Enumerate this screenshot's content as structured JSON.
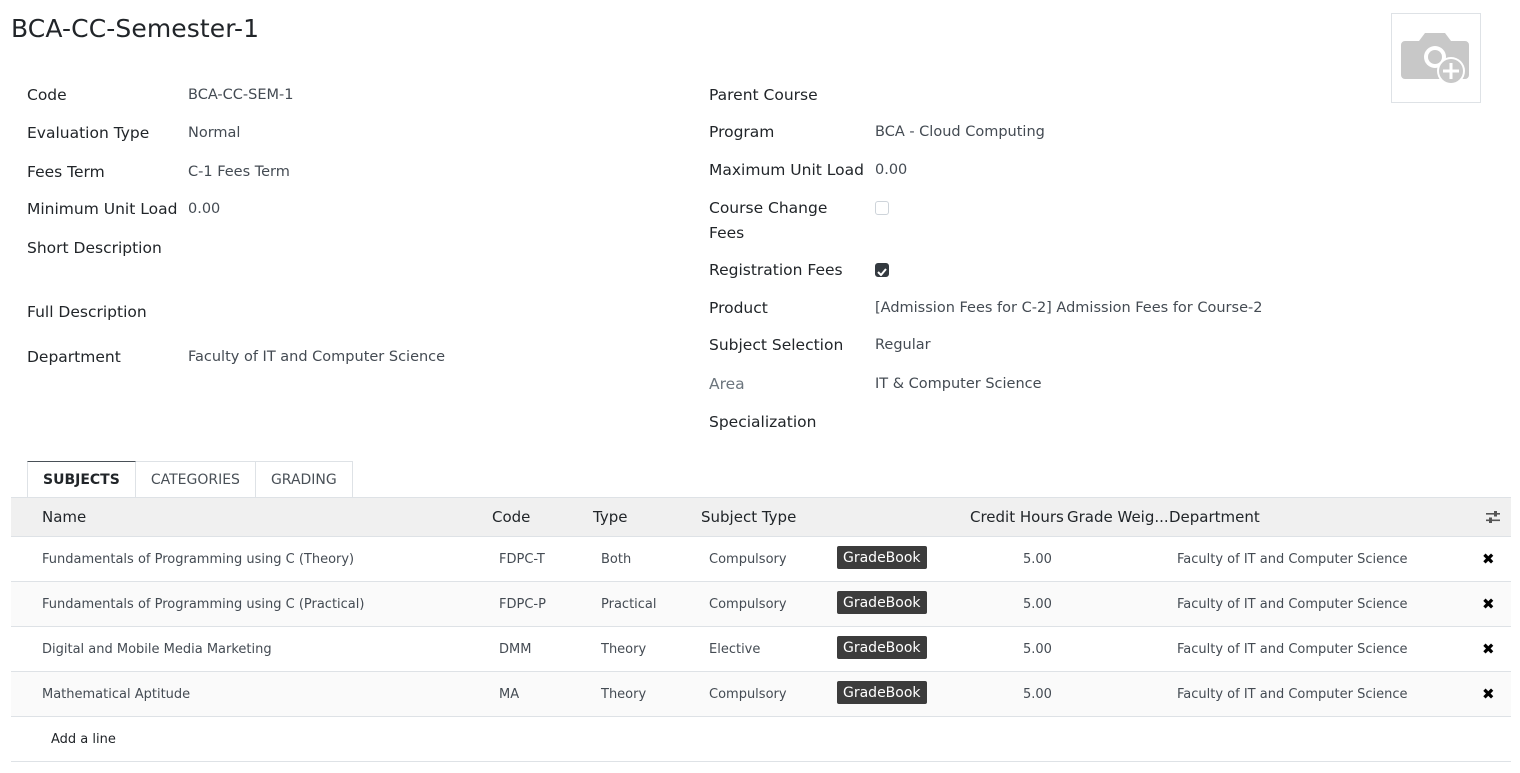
{
  "title": "BCA-CC-Semester-1",
  "avatar": {
    "icon": "camera-plus-icon"
  },
  "left_fields": [
    {
      "label": "Code",
      "value": "BCA-CC-SEM-1"
    },
    {
      "label": "Evaluation Type",
      "value": "Normal"
    },
    {
      "label": "Fees Term",
      "value": "C-1 Fees Term"
    },
    {
      "label": "Minimum Unit Load",
      "value": "0.00"
    },
    {
      "label": "Short Description",
      "value": ""
    },
    {
      "label": "Full Description",
      "value": ""
    },
    {
      "label": "Department",
      "value": "Faculty of IT and Computer Science"
    }
  ],
  "right_fields": {
    "parent_course": {
      "label": "Parent Course",
      "value": ""
    },
    "program": {
      "label": "Program",
      "value": "BCA - Cloud Computing"
    },
    "max_unit_load": {
      "label": "Maximum Unit Load",
      "value": "0.00"
    },
    "course_change_fees": {
      "label_line1": "Course Change",
      "label_line2": "Fees",
      "checked": false
    },
    "registration_fees": {
      "label": "Registration Fees",
      "checked": true
    },
    "product": {
      "label": "Product",
      "value": "[Admission Fees for C-2] Admission Fees for Course-2"
    },
    "subject_selection": {
      "label": "Subject Selection",
      "value": "Regular"
    },
    "area": {
      "label": "Area",
      "value": "IT & Computer Science"
    },
    "specialization": {
      "label": "Specialization",
      "value": ""
    }
  },
  "tabs": [
    "SUBJECTS",
    "CATEGORIES",
    "GRADING"
  ],
  "table": {
    "headers": {
      "name": "Name",
      "code": "Code",
      "type": "Type",
      "subject_type": "Subject Type",
      "credit_hours": "Credit Hours",
      "grade_weight": "Grade Weig...",
      "department": "Department"
    },
    "button_label": "GradeBook",
    "rows": [
      {
        "name": "Fundamentals of Programming using C (Theory)",
        "code": "FDPC-T",
        "type": "Both",
        "subject_type": "Compulsory",
        "credit_hours": "5.00",
        "department": "Faculty of IT and Computer Science"
      },
      {
        "name": "Fundamentals of Programming using C (Practical)",
        "code": "FDPC-P",
        "type": "Practical",
        "subject_type": "Compulsory",
        "credit_hours": "5.00",
        "department": "Faculty of IT and Computer Science"
      },
      {
        "name": "Digital and Mobile Media Marketing",
        "code": "DMM",
        "type": "Theory",
        "subject_type": "Elective",
        "credit_hours": "5.00",
        "department": "Faculty of IT and Computer Science"
      },
      {
        "name": "Mathematical Aptitude",
        "code": "MA",
        "type": "Theory",
        "subject_type": "Compulsory",
        "credit_hours": "5.00",
        "department": "Faculty of IT and Computer Science"
      }
    ],
    "add_line": "Add a line",
    "delete_icon": "times-icon",
    "settings_icon": "sliders-icon"
  }
}
